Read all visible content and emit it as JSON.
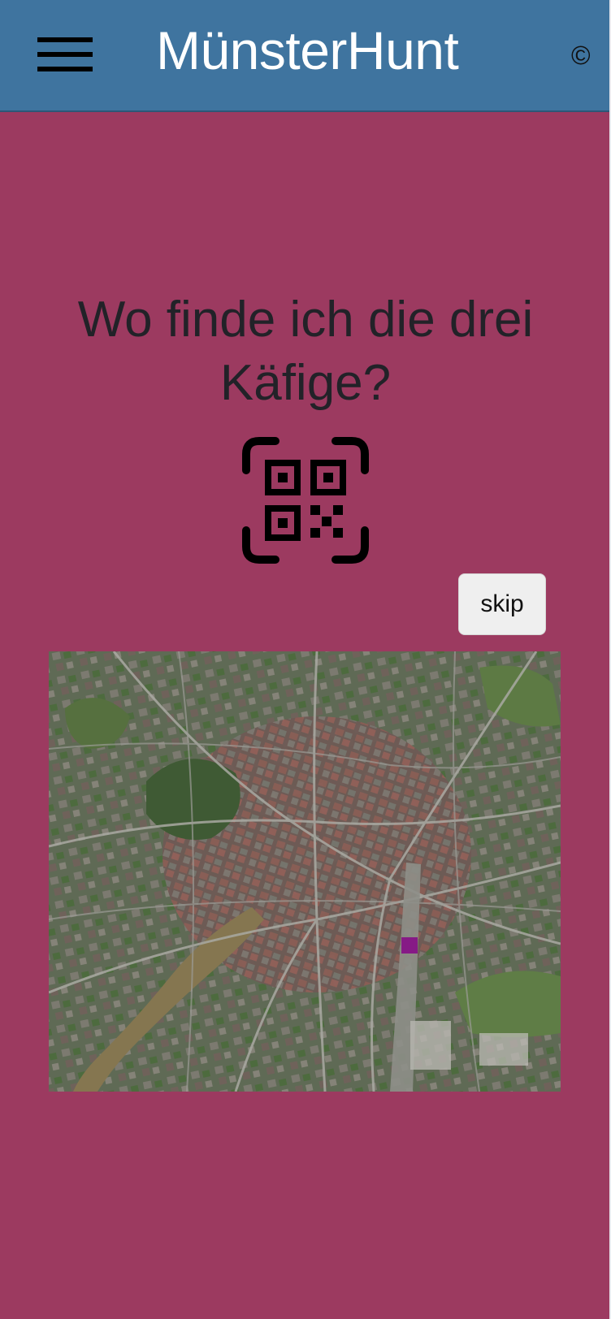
{
  "header": {
    "menu_icon": "hamburger-menu-icon",
    "title": "MünsterHunt",
    "copyright_symbol": "©"
  },
  "task": {
    "question": "Wo finde ich die drei Käfige?",
    "scan_icon": "qr-code-scan-icon"
  },
  "actions": {
    "skip_label": "skip"
  },
  "map": {
    "type": "satellite",
    "marker_color": "#861a86"
  },
  "colors": {
    "header_background": "#3f749f",
    "page_background": "#9c3a60",
    "title_text": "#ffffff",
    "question_text": "#222228"
  }
}
